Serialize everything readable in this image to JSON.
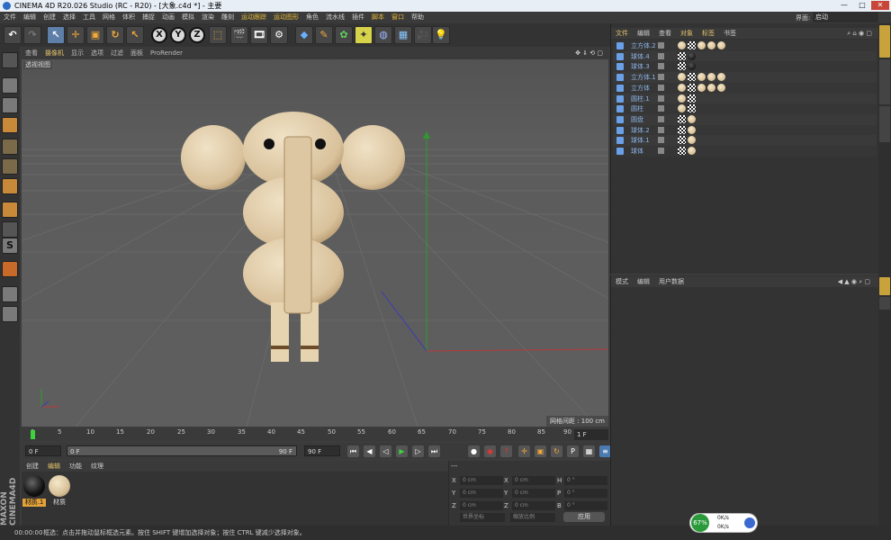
{
  "window": {
    "title": "CINEMA 4D R20.026 Studio (RC - R20) - [大象.c4d *] - 主要",
    "minimize": "—",
    "maximize": "□",
    "close": "✕"
  },
  "menubar": {
    "items": [
      "文件",
      "编辑",
      "创建",
      "选择",
      "工具",
      "网格",
      "体积",
      "捕捉",
      "动画",
      "模拟",
      "渲染",
      "雕刻",
      "运动跟踪",
      "运动图形",
      "角色",
      "流水线",
      "插件",
      "脚本",
      "窗口",
      "帮助"
    ],
    "layout_label": "界面:",
    "layout_value": "启动"
  },
  "toolbar": {
    "undo": "↶",
    "redo": "↷",
    "x": "X",
    "y": "Y",
    "z": "Z"
  },
  "viewport": {
    "menu": [
      "查看",
      "摄像机",
      "显示",
      "选项",
      "过滤",
      "面板",
      "ProRender"
    ],
    "label": "透视视图",
    "grid_spacing": "网格间距 : 100 cm"
  },
  "timeline": {
    "ticks": [
      "0",
      "5",
      "10",
      "15",
      "20",
      "25",
      "30",
      "35",
      "40",
      "45",
      "50",
      "55",
      "60",
      "65",
      "70",
      "75",
      "80",
      "85",
      "90"
    ],
    "current_frame": "1 F",
    "start": "0 F",
    "preview_start": "0 F",
    "preview_end": "90 F",
    "end": "90 F"
  },
  "materials": {
    "tabs": [
      "创建",
      "编辑",
      "功能",
      "纹理"
    ],
    "items": [
      {
        "name": "材质.1",
        "color": "#111111"
      },
      {
        "name": "材质",
        "color": "#d8c19a"
      }
    ]
  },
  "coords": {
    "header": "---",
    "rows": [
      {
        "a": "X",
        "av": "0 cm",
        "b": "X",
        "bv": "0 cm",
        "c": "H",
        "cv": "0 °"
      },
      {
        "a": "Y",
        "av": "0 cm",
        "b": "Y",
        "bv": "0 cm",
        "c": "P",
        "cv": "0 °"
      },
      {
        "a": "Z",
        "av": "0 cm",
        "b": "Z",
        "bv": "0 cm",
        "c": "B",
        "cv": "0 °"
      }
    ],
    "world": "世界坐标",
    "scale": "缩放比例",
    "apply": "应用"
  },
  "objects": {
    "tabs": [
      "文件",
      "编辑",
      "查看",
      "对象",
      "标签",
      "书签"
    ],
    "rows": [
      {
        "name": "立方体.2",
        "tags": [
          "wood",
          "check",
          "wood",
          "wood",
          "wood"
        ]
      },
      {
        "name": "球体.4",
        "tags": [
          "check",
          "black"
        ]
      },
      {
        "name": "球体.3",
        "tags": [
          "check",
          "black"
        ]
      },
      {
        "name": "立方体.1",
        "tags": [
          "wood",
          "check",
          "wood",
          "wood",
          "wood"
        ]
      },
      {
        "name": "立方体",
        "tags": [
          "wood",
          "check",
          "wood",
          "wood",
          "wood"
        ]
      },
      {
        "name": "圆柱.1",
        "tags": [
          "wood",
          "check"
        ]
      },
      {
        "name": "圆柱",
        "tags": [
          "wood",
          "check"
        ]
      },
      {
        "name": "圆盘",
        "tags": [
          "check",
          "wood"
        ]
      },
      {
        "name": "球体.2",
        "tags": [
          "check",
          "wood"
        ]
      },
      {
        "name": "球体.1",
        "tags": [
          "check",
          "wood"
        ]
      },
      {
        "name": "球体",
        "tags": [
          "check",
          "wood"
        ]
      }
    ]
  },
  "attributes": {
    "tabs": [
      "模式",
      "编辑",
      "用户数据"
    ]
  },
  "status": {
    "time": "00:00:00",
    "text": "框选：点击并拖动鼠标框选元素。按住 SHIFT 键增加选择对象；按住 CTRL 键减少选择对象。"
  },
  "netwidget": {
    "percent": "67%",
    "up": "0K/s",
    "down": "0K/s"
  },
  "colors": {
    "accent": "#e3c36a",
    "wood": "#e2cfae",
    "objname": "#8cb5e8"
  }
}
